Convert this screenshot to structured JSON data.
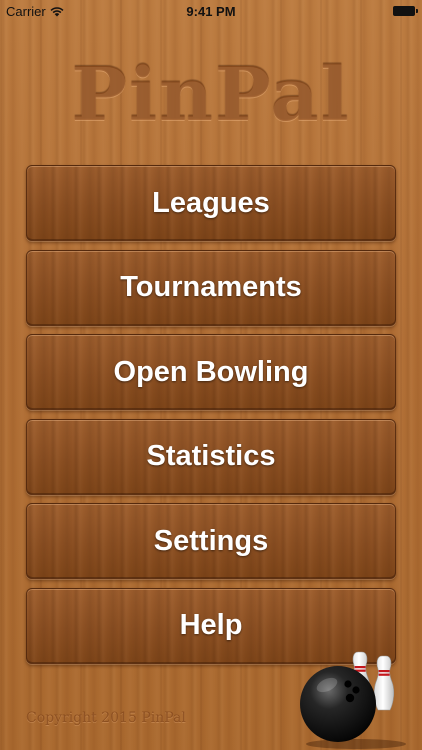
{
  "status_bar": {
    "carrier": "Carrier",
    "time": "9:41 PM",
    "wifi_icon": "wifi-icon",
    "battery_icon": "battery-icon"
  },
  "app": {
    "title": "PinPal"
  },
  "menu": {
    "items": [
      {
        "label": "Leagues"
      },
      {
        "label": "Tournaments"
      },
      {
        "label": "Open Bowling"
      },
      {
        "label": "Statistics"
      },
      {
        "label": "Settings"
      },
      {
        "label": "Help"
      }
    ]
  },
  "footer": {
    "copyright": "Copyright 2015 PinPal",
    "illustration_icon": "bowling-ball-and-pins-icon"
  },
  "colors": {
    "background_wood": "#b4733a",
    "button_wood": "#8f5326",
    "button_text": "#ffffff",
    "title_engraved": "#8c4819"
  }
}
